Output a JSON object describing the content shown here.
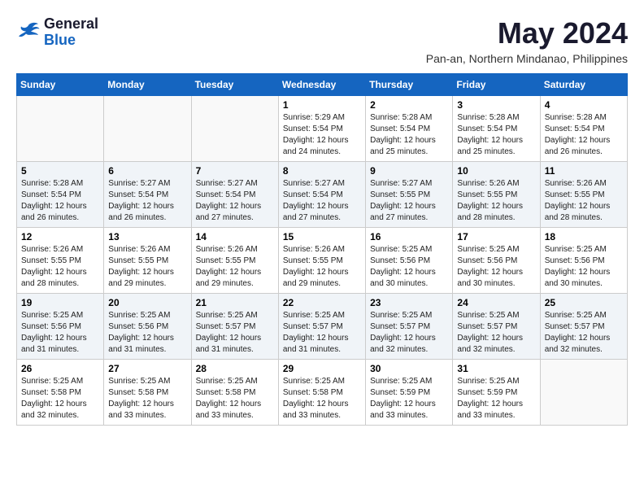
{
  "logo": {
    "line1": "General",
    "line2": "Blue"
  },
  "title": "May 2024",
  "location": "Pan-an, Northern Mindanao, Philippines",
  "days_of_week": [
    "Sunday",
    "Monday",
    "Tuesday",
    "Wednesday",
    "Thursday",
    "Friday",
    "Saturday"
  ],
  "weeks": [
    [
      {
        "day": "",
        "info": ""
      },
      {
        "day": "",
        "info": ""
      },
      {
        "day": "",
        "info": ""
      },
      {
        "day": "1",
        "info": "Sunrise: 5:29 AM\nSunset: 5:54 PM\nDaylight: 12 hours\nand 24 minutes."
      },
      {
        "day": "2",
        "info": "Sunrise: 5:28 AM\nSunset: 5:54 PM\nDaylight: 12 hours\nand 25 minutes."
      },
      {
        "day": "3",
        "info": "Sunrise: 5:28 AM\nSunset: 5:54 PM\nDaylight: 12 hours\nand 25 minutes."
      },
      {
        "day": "4",
        "info": "Sunrise: 5:28 AM\nSunset: 5:54 PM\nDaylight: 12 hours\nand 26 minutes."
      }
    ],
    [
      {
        "day": "5",
        "info": "Sunrise: 5:28 AM\nSunset: 5:54 PM\nDaylight: 12 hours\nand 26 minutes."
      },
      {
        "day": "6",
        "info": "Sunrise: 5:27 AM\nSunset: 5:54 PM\nDaylight: 12 hours\nand 26 minutes."
      },
      {
        "day": "7",
        "info": "Sunrise: 5:27 AM\nSunset: 5:54 PM\nDaylight: 12 hours\nand 27 minutes."
      },
      {
        "day": "8",
        "info": "Sunrise: 5:27 AM\nSunset: 5:54 PM\nDaylight: 12 hours\nand 27 minutes."
      },
      {
        "day": "9",
        "info": "Sunrise: 5:27 AM\nSunset: 5:55 PM\nDaylight: 12 hours\nand 27 minutes."
      },
      {
        "day": "10",
        "info": "Sunrise: 5:26 AM\nSunset: 5:55 PM\nDaylight: 12 hours\nand 28 minutes."
      },
      {
        "day": "11",
        "info": "Sunrise: 5:26 AM\nSunset: 5:55 PM\nDaylight: 12 hours\nand 28 minutes."
      }
    ],
    [
      {
        "day": "12",
        "info": "Sunrise: 5:26 AM\nSunset: 5:55 PM\nDaylight: 12 hours\nand 28 minutes."
      },
      {
        "day": "13",
        "info": "Sunrise: 5:26 AM\nSunset: 5:55 PM\nDaylight: 12 hours\nand 29 minutes."
      },
      {
        "day": "14",
        "info": "Sunrise: 5:26 AM\nSunset: 5:55 PM\nDaylight: 12 hours\nand 29 minutes."
      },
      {
        "day": "15",
        "info": "Sunrise: 5:26 AM\nSunset: 5:55 PM\nDaylight: 12 hours\nand 29 minutes."
      },
      {
        "day": "16",
        "info": "Sunrise: 5:25 AM\nSunset: 5:56 PM\nDaylight: 12 hours\nand 30 minutes."
      },
      {
        "day": "17",
        "info": "Sunrise: 5:25 AM\nSunset: 5:56 PM\nDaylight: 12 hours\nand 30 minutes."
      },
      {
        "day": "18",
        "info": "Sunrise: 5:25 AM\nSunset: 5:56 PM\nDaylight: 12 hours\nand 30 minutes."
      }
    ],
    [
      {
        "day": "19",
        "info": "Sunrise: 5:25 AM\nSunset: 5:56 PM\nDaylight: 12 hours\nand 31 minutes."
      },
      {
        "day": "20",
        "info": "Sunrise: 5:25 AM\nSunset: 5:56 PM\nDaylight: 12 hours\nand 31 minutes."
      },
      {
        "day": "21",
        "info": "Sunrise: 5:25 AM\nSunset: 5:57 PM\nDaylight: 12 hours\nand 31 minutes."
      },
      {
        "day": "22",
        "info": "Sunrise: 5:25 AM\nSunset: 5:57 PM\nDaylight: 12 hours\nand 31 minutes."
      },
      {
        "day": "23",
        "info": "Sunrise: 5:25 AM\nSunset: 5:57 PM\nDaylight: 12 hours\nand 32 minutes."
      },
      {
        "day": "24",
        "info": "Sunrise: 5:25 AM\nSunset: 5:57 PM\nDaylight: 12 hours\nand 32 minutes."
      },
      {
        "day": "25",
        "info": "Sunrise: 5:25 AM\nSunset: 5:57 PM\nDaylight: 12 hours\nand 32 minutes."
      }
    ],
    [
      {
        "day": "26",
        "info": "Sunrise: 5:25 AM\nSunset: 5:58 PM\nDaylight: 12 hours\nand 32 minutes."
      },
      {
        "day": "27",
        "info": "Sunrise: 5:25 AM\nSunset: 5:58 PM\nDaylight: 12 hours\nand 33 minutes."
      },
      {
        "day": "28",
        "info": "Sunrise: 5:25 AM\nSunset: 5:58 PM\nDaylight: 12 hours\nand 33 minutes."
      },
      {
        "day": "29",
        "info": "Sunrise: 5:25 AM\nSunset: 5:58 PM\nDaylight: 12 hours\nand 33 minutes."
      },
      {
        "day": "30",
        "info": "Sunrise: 5:25 AM\nSunset: 5:59 PM\nDaylight: 12 hours\nand 33 minutes."
      },
      {
        "day": "31",
        "info": "Sunrise: 5:25 AM\nSunset: 5:59 PM\nDaylight: 12 hours\nand 33 minutes."
      },
      {
        "day": "",
        "info": ""
      }
    ]
  ]
}
